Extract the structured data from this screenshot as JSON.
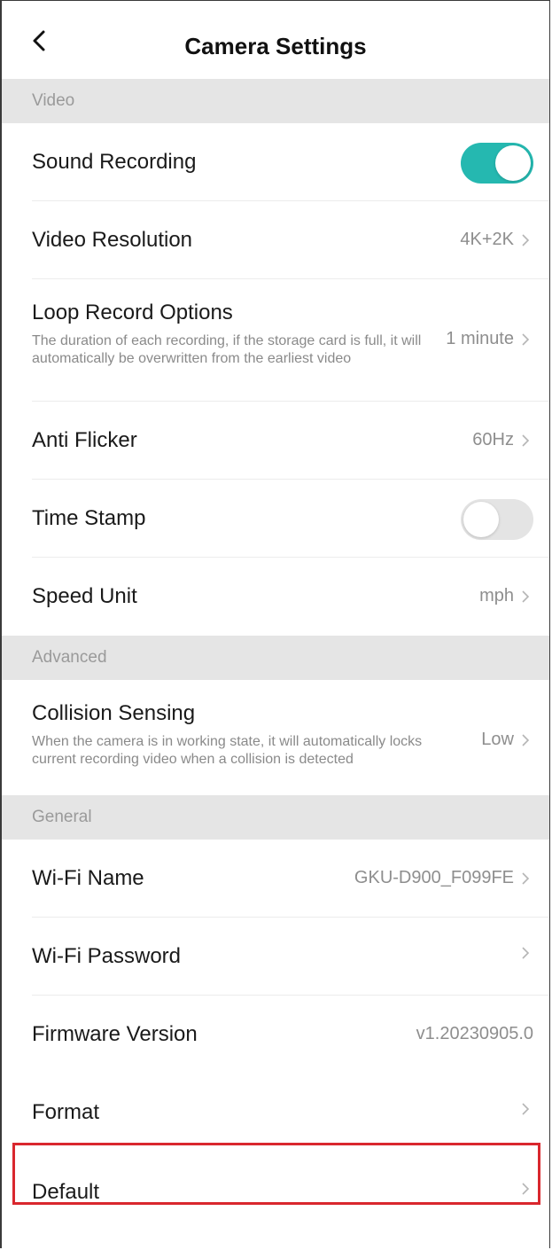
{
  "header": {
    "title": "Camera Settings",
    "back_icon": "chevron-left-icon"
  },
  "sections": {
    "video": "Video",
    "advanced": "Advanced",
    "general": "General"
  },
  "rows": {
    "sound_recording": {
      "label": "Sound Recording",
      "toggle": "on"
    },
    "video_resolution": {
      "label": "Video Resolution",
      "value": "4K+2K"
    },
    "loop_record": {
      "label": "Loop Record Options",
      "desc": "The duration of each recording, if the storage card is full, it will automatically be overwritten from the earliest video",
      "value": "1 minute"
    },
    "anti_flicker": {
      "label": "Anti Flicker",
      "value": "60Hz"
    },
    "time_stamp": {
      "label": "Time Stamp",
      "toggle": "off"
    },
    "speed_unit": {
      "label": "Speed Unit",
      "value": "mph"
    },
    "collision_sensing": {
      "label": "Collision Sensing",
      "desc": "When the camera is in working state, it will automatically locks current recording video when a collision is detected",
      "value": "Low"
    },
    "wifi_name": {
      "label": "Wi-Fi Name",
      "value": "GKU-D900_F099FE"
    },
    "wifi_password": {
      "label": "Wi-Fi Password",
      "value": ""
    },
    "firmware_version": {
      "label": "Firmware Version",
      "value": "v1.20230905.0"
    },
    "format": {
      "label": "Format",
      "value": ""
    },
    "default": {
      "label": "Default",
      "value": ""
    }
  },
  "colors": {
    "toggle_on": "#25b8b0",
    "toggle_off": "#e4e4e4",
    "section_bg": "#e5e5e5",
    "highlight_border": "#d9272e"
  },
  "icons": {
    "row_chevron": "chevron-right-icon"
  }
}
